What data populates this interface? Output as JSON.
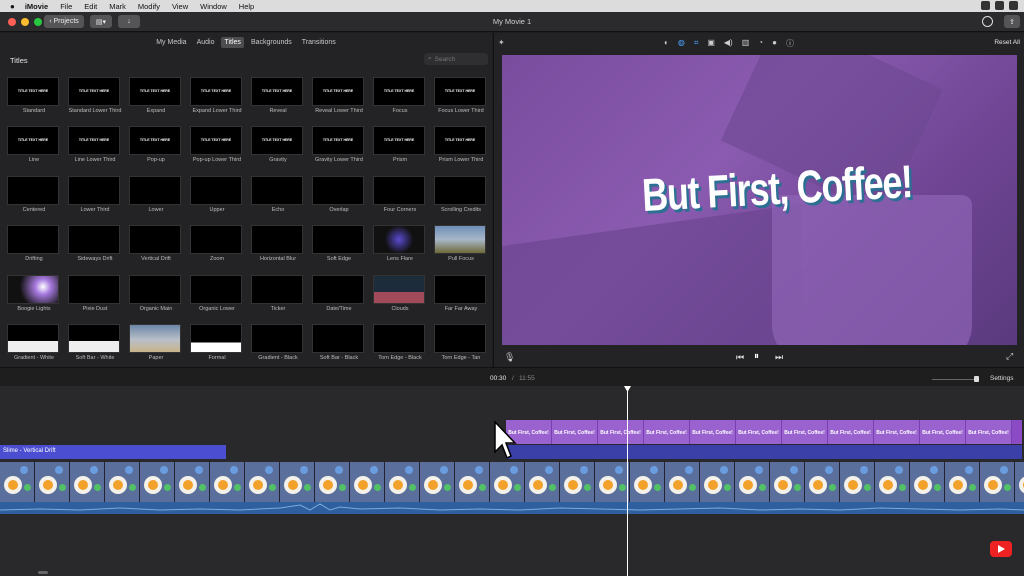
{
  "menubar": {
    "apple": "",
    "app": "iMovie",
    "items": [
      "File",
      "Edit",
      "Mark",
      "Modify",
      "View",
      "Window",
      "Help"
    ]
  },
  "titlebar": {
    "back_label": "Projects",
    "window_title": "My Movie 1"
  },
  "browser": {
    "tabs": [
      {
        "label": "My Media",
        "active": false
      },
      {
        "label": "Audio",
        "active": false
      },
      {
        "label": "Titles",
        "active": true
      },
      {
        "label": "Backgrounds",
        "active": false
      },
      {
        "label": "Transitions",
        "active": false
      }
    ],
    "section_title": "Titles",
    "search_placeholder": "Search",
    "titles": [
      [
        "Standard",
        "Standard Lower Third",
        "Expand",
        "Expand Lower Third",
        "Reveal",
        "Reveal Lower Third",
        "Focus",
        "Focus Lower Third"
      ],
      [
        "Line",
        "Line Lower Third",
        "Pop-up",
        "Pop-up Lower Third",
        "Gravity",
        "Gravity Lower Third",
        "Prism",
        "Prism Lower Third"
      ],
      [
        "Centered",
        "Lower Third",
        "Lower",
        "Upper",
        "Echo",
        "Overlap",
        "Four Corners",
        "Scrolling Credits"
      ],
      [
        "Drifting",
        "Sideways Drift",
        "Vertical Drift",
        "Zoom",
        "Horizontal Blur",
        "Soft Edge",
        "Lens Flare",
        "Pull Focus"
      ],
      [
        "Boogie Lights",
        "Pixie Dust",
        "Organic Main",
        "Organic Lower",
        "Ticker",
        "Date/Time",
        "Clouds",
        "Far Far Away"
      ],
      [
        "Gradient - White",
        "Soft Bar - White",
        "Paper",
        "Formal",
        "Gradient - Black",
        "Soft Bar - Black",
        "Torn Edge - Black",
        "Torn Edge - Tan"
      ]
    ],
    "thumb_text": "TITLE TEXT HERE"
  },
  "viewer": {
    "reset_label": "Reset All",
    "headline": "But First, Coffee!"
  },
  "timeline": {
    "current_time": "00:30",
    "separator": "/",
    "total_time": "11:55",
    "settings_label": "Settings",
    "slime_clip_label": "Slime - Vertical Drift",
    "title_clip_label": "But First, Coffee!"
  },
  "colors": {
    "accent_purple": "#8a4bc5",
    "title_clip_blue": "#4b4ed0",
    "audio_blue": "#2f5f9e",
    "preview_purple": "#7a4c9e"
  }
}
